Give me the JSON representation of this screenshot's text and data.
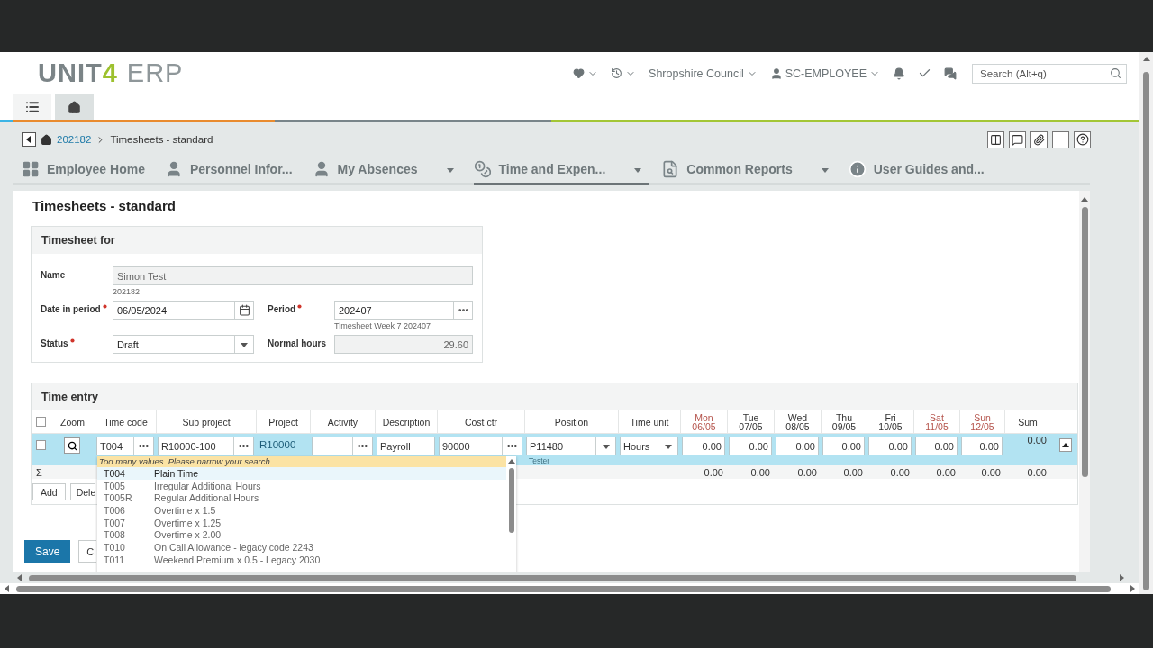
{
  "header": {
    "logo": {
      "brand": "UNIT",
      "mark": "4",
      "product": "ERP"
    },
    "company": "Shropshire Council",
    "user": "SC-EMPLOYEE",
    "search": {
      "placeholder": "Search (Alt+q)"
    }
  },
  "app_tabs": [
    {
      "kind": "menu",
      "selected": false
    },
    {
      "kind": "home",
      "selected": true
    }
  ],
  "breadcrumb": {
    "link": "202182",
    "current": "Timesheets - standard"
  },
  "nav": [
    {
      "label": "Employee Home",
      "kind": "grid",
      "dropdown": false,
      "selected": false
    },
    {
      "label": "Personnel Infor...",
      "kind": "person",
      "dropdown": false,
      "selected": false
    },
    {
      "label": "My Absences",
      "kind": "person",
      "dropdown": true,
      "selected": false
    },
    {
      "label": "Time and Expen...",
      "kind": "coins",
      "dropdown": true,
      "selected": true
    },
    {
      "label": "Common Reports",
      "kind": "report",
      "dropdown": true,
      "selected": false
    },
    {
      "label": "User Guides and...",
      "kind": "info",
      "dropdown": false,
      "selected": false
    }
  ],
  "page_title": "Timesheets - standard",
  "timesheet_for": {
    "title": "Timesheet for",
    "name": {
      "label": "Name",
      "value": "Simon Test",
      "note": "202182"
    },
    "date_in_period": {
      "label": "Date in period",
      "required": true,
      "value": "06/05/2024"
    },
    "period": {
      "label": "Period",
      "required": true,
      "value": "202407",
      "note": "Timesheet Week 7 202407"
    },
    "status": {
      "label": "Status",
      "required": true,
      "value": "Draft"
    },
    "normal_hours": {
      "label": "Normal hours",
      "required": false,
      "value": "29.60"
    }
  },
  "time_entry": {
    "title": "Time entry",
    "all_checked": false,
    "columns": [
      {
        "label": "Zoom",
        "holiday": false
      },
      {
        "label": "Time code",
        "holiday": false
      },
      {
        "label": "Sub project",
        "holiday": false
      },
      {
        "label": "Project",
        "holiday": false
      },
      {
        "label": "Activity",
        "holiday": false
      },
      {
        "label": "Description",
        "holiday": false
      },
      {
        "label": "Cost ctr",
        "holiday": false
      },
      {
        "label": "Position",
        "holiday": false
      },
      {
        "label": "Time unit",
        "holiday": false
      },
      {
        "label": "Mon",
        "sub": "06/05",
        "holiday": true
      },
      {
        "label": "Tue",
        "sub": "07/05",
        "holiday": false
      },
      {
        "label": "Wed",
        "sub": "08/05",
        "holiday": false
      },
      {
        "label": "Thu",
        "sub": "09/05",
        "holiday": false
      },
      {
        "label": "Fri",
        "sub": "10/05",
        "holiday": false
      },
      {
        "label": "Sat",
        "sub": "11/05",
        "holiday": true
      },
      {
        "label": "Sun",
        "sub": "12/05",
        "holiday": true
      },
      {
        "label": "Sum",
        "holiday": false
      }
    ],
    "rows": [
      {
        "selected": true,
        "checked": false,
        "time_code": "T004",
        "sub_project": "R10000-100",
        "project": "R10000",
        "description": "Payroll",
        "cost_ctr": "90000",
        "position": "P11480",
        "position_note": "Tester",
        "time_unit": "Hours",
        "days": [
          "0.00",
          "0.00",
          "0.00",
          "0.00",
          "0.00",
          "0.00",
          "0.00"
        ],
        "sum": "0.00"
      }
    ],
    "totals": {
      "symbol": "Σ",
      "values": [
        "0.00",
        "0.00",
        "0.00",
        "0.00",
        "0.00",
        "0.00",
        "0.00",
        "0.00"
      ]
    },
    "buttons": [
      "Add",
      "Dele"
    ]
  },
  "lookup": {
    "message": "Too many values. Please narrow your search.",
    "items": [
      {
        "code": "T004",
        "name": "Plain Time",
        "selected": true
      },
      {
        "code": "T005",
        "name": "Irregular Additional Hours",
        "selected": false
      },
      {
        "code": "T005R",
        "name": "Regular Additional Hours",
        "selected": false
      },
      {
        "code": "T006",
        "name": "Overtime x 1.5",
        "selected": false
      },
      {
        "code": "T007",
        "name": "Overtime x 1.25",
        "selected": false
      },
      {
        "code": "T008",
        "name": "Overtime x 2.00",
        "selected": false
      },
      {
        "code": "T010",
        "name": "On Call Allowance - legacy code 2243",
        "selected": false
      },
      {
        "code": "T011",
        "name": "Weekend Premium x 0.5 - Legacy 2030",
        "selected": false
      }
    ]
  },
  "footer_buttons": [
    "Save",
    "Cl"
  ]
}
